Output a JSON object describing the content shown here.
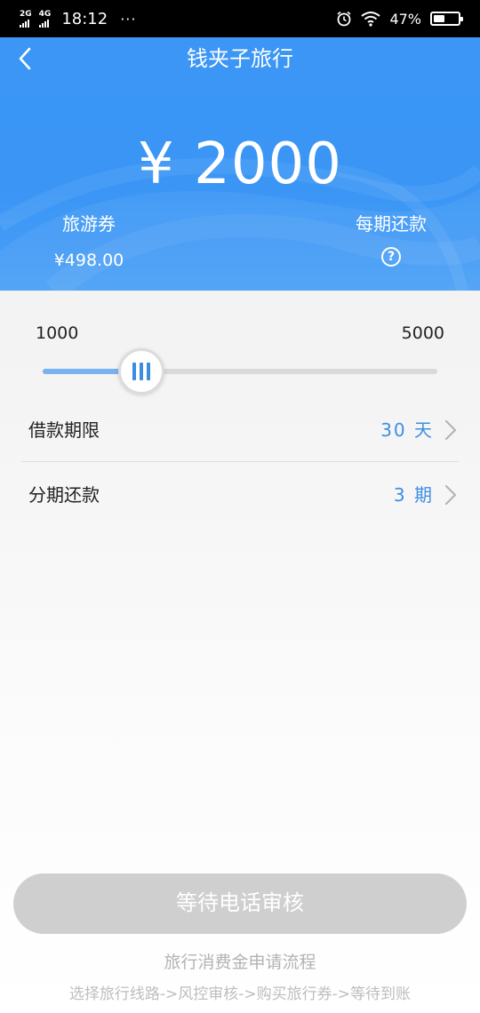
{
  "status_bar": {
    "network1": "2G",
    "network2": "4G",
    "time": "18:12",
    "more": "···",
    "battery_percent": "47%",
    "battery_level": 0.47
  },
  "header": {
    "title": "钱夹子旅行",
    "amount": "¥ 2000",
    "voucher_label": "旅游券",
    "voucher_value": "¥498.00",
    "repay_label": "每期还款",
    "help_glyph": "?",
    "color": "#3b96f6"
  },
  "slider": {
    "min_label": "1000",
    "max_label": "5000",
    "min": 1000,
    "max": 5000,
    "value": 2000
  },
  "rows": [
    {
      "label": "借款期限",
      "value": "30 天"
    },
    {
      "label": "分期还款",
      "value": "3 期"
    }
  ],
  "submit_button": {
    "label": "等待电话审核"
  },
  "flow": {
    "title": "旅行消费金申请流程",
    "steps": "选择旅行线路->风控审核->购买旅行券->等待到账"
  },
  "colors": {
    "accent": "#3d8fe3",
    "slider_fill": "#78b2ef",
    "disabled_button": "#cfcfcf"
  }
}
